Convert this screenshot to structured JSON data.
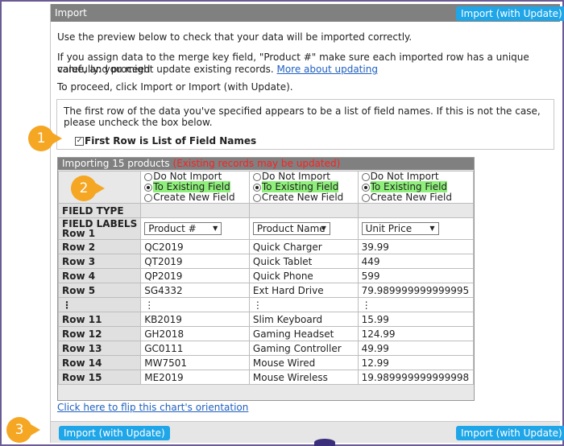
{
  "header": {
    "title": "Import",
    "import_update_label": "Import (with Update)"
  },
  "intro": {
    "line1": "Use the preview below to check that your data will be imported correctly.",
    "line2a": "If you assign data to the merge key field, \"Product #\" make sure each imported row has a unique value, and proceed",
    "line2b": "carefully: you might update existing records.",
    "more_link": "More about updating",
    "line3": "To proceed, click Import or Import (with Update)."
  },
  "first_row": {
    "message": "The first row of the data you've specified appears to be a list of field names. If this is not the case, please uncheck the box below.",
    "checkbox_label": "First Row is List of Field Names",
    "checked": true
  },
  "grid": {
    "heading": "Importing 15 products",
    "warning": "(Existing records may be updated)",
    "radio_options": [
      "Do Not Import",
      "To Existing Field",
      "Create New Field"
    ],
    "selected_option": "To Existing Field",
    "field_type_label": "FIELD TYPE",
    "field_labels_label": "FIELD LABELS",
    "row1_label": "Row 1",
    "columns": [
      "Product #",
      "Product Name",
      "Unit Price"
    ],
    "rows": [
      {
        "label": "Row 2",
        "cells": [
          "QC2019",
          "Quick Charger",
          "39.99"
        ]
      },
      {
        "label": "Row 3",
        "cells": [
          "QT2019",
          "Quick Tablet",
          "449"
        ]
      },
      {
        "label": "Row 4",
        "cells": [
          "QP2019",
          "Quick Phone",
          "599"
        ]
      },
      {
        "label": "Row 5",
        "cells": [
          "SG4332",
          "Ext Hard Drive",
          "79.989999999999995"
        ]
      },
      {
        "label": "⋮",
        "cells": [
          "⋮",
          "⋮",
          "⋮"
        ]
      },
      {
        "label": "Row 11",
        "cells": [
          "KB2019",
          "Slim Keyboard",
          "15.99"
        ]
      },
      {
        "label": "Row 12",
        "cells": [
          "GH2018",
          "Gaming Headset",
          "124.99"
        ]
      },
      {
        "label": "Row 13",
        "cells": [
          "GC0111",
          "Gaming Controller",
          "49.99"
        ]
      },
      {
        "label": "Row 14",
        "cells": [
          "MW7501",
          "Mouse Wired",
          "12.99"
        ]
      },
      {
        "label": "Row 15",
        "cells": [
          "ME2019",
          "Mouse Wireless",
          "19.989999999999998"
        ]
      }
    ]
  },
  "flip_link": "Click here to flip this chart's orientation",
  "footer": {
    "left_button": "Import (with Update)",
    "right_button": "Import (with Update)"
  },
  "callouts": [
    "1",
    "2",
    "3"
  ],
  "colors": {
    "accent": "#1fa6e8",
    "callout": "#f5a623",
    "header": "#808080",
    "highlight": "#8ef07a",
    "warning": "#ff2020",
    "link": "#2060c0"
  }
}
